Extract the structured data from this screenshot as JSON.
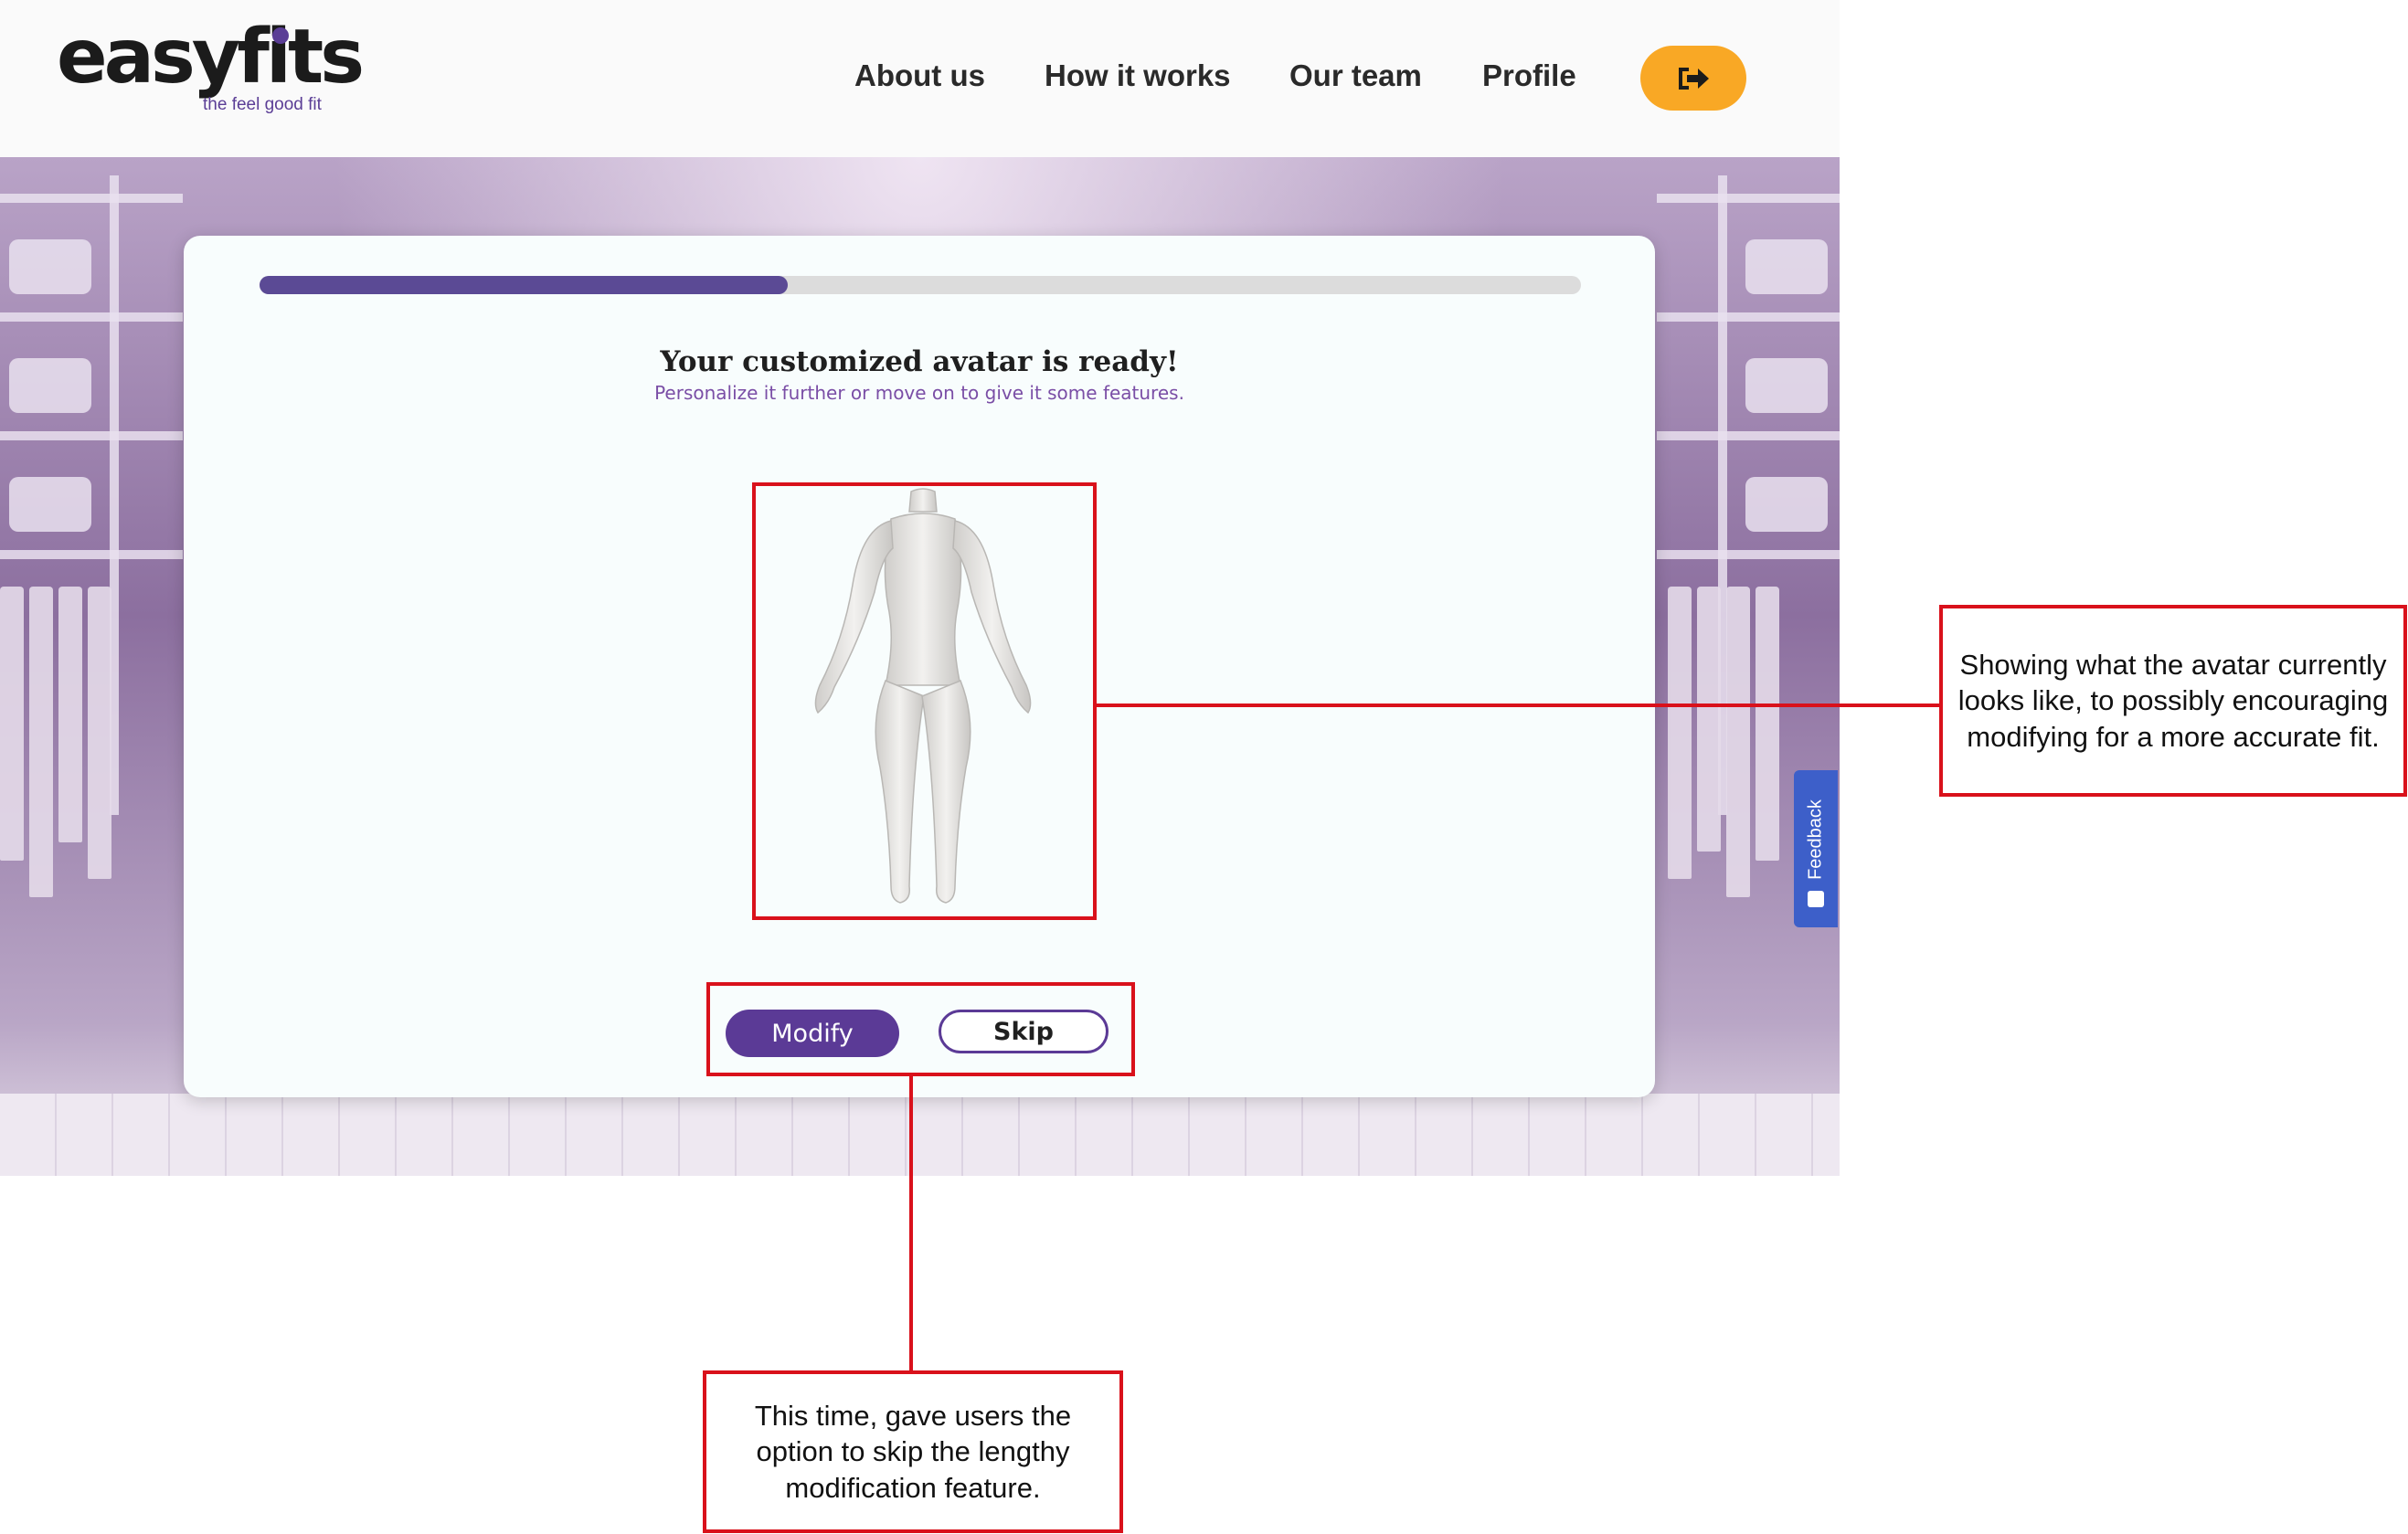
{
  "header": {
    "logo": {
      "wordmark": "easyfits",
      "tagline": "the feel good fit"
    },
    "nav": [
      {
        "label": "About us"
      },
      {
        "label": "How it works"
      },
      {
        "label": "Our team"
      },
      {
        "label": "Profile"
      }
    ],
    "logout_icon": "sign-out-icon"
  },
  "card": {
    "progress": 0.4,
    "title": "Your customized avatar is ready!",
    "subtitle": "Personalize it further or move on to give it some features.",
    "avatar_icon": "avatar-mannequin",
    "buttons": {
      "modify": "Modify",
      "skip": "Skip"
    }
  },
  "feedback_tab": {
    "label": "Feedback"
  },
  "annotations": {
    "avatar_note": "Showing what the avatar currently looks like, to possibly encouraging modifying for a more accurate fit.",
    "skip_note": "This time, gave users the option to skip the lengthy modification feature."
  },
  "colors": {
    "brand_purple": "#5b3a96",
    "accent_orange": "#f9a825",
    "annotation_red": "#d9111b",
    "feedback_blue": "#3d5fc9"
  }
}
